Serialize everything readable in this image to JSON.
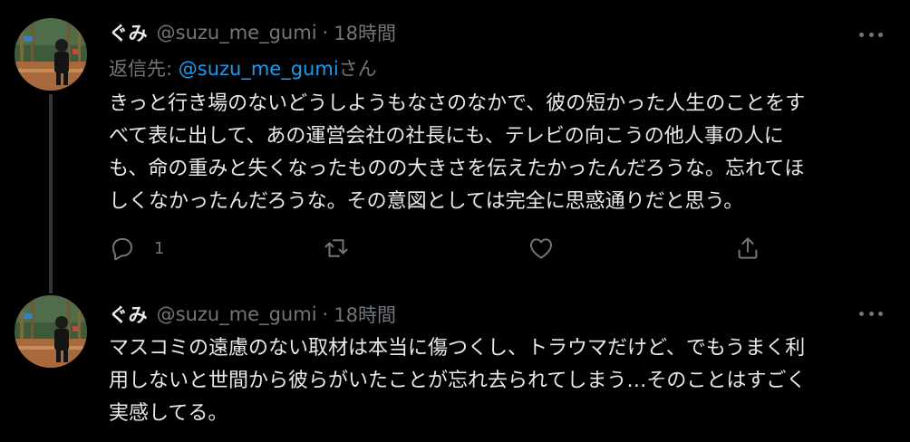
{
  "colors": {
    "background": "#000000",
    "primary_text": "#e7e9ea",
    "secondary_text": "#71767b",
    "link": "#1d9bf0",
    "thread_line": "#333639"
  },
  "tweets": [
    {
      "display_name": "ぐみ",
      "handle": "@suzu_me_gumi",
      "separator": "·",
      "time": "18時間",
      "reply_label": "返信先: ",
      "reply_mention": "@suzu_me_gumi",
      "reply_suffix": "さん",
      "lines": [
        "きっと行き場のないどうしようもなさのなかで、彼の短かった人生のことをす",
        "べて表に出して、あの運営会社の社長にも、テレビの向こうの他人事の人に",
        "も、命の重みと失くなったものの大きさを伝えたかったんだろうな。忘れてほ",
        "しくなかったんだろうな。その意図としては完全に思惑通りだと思う。"
      ],
      "reply_count": "1",
      "icons": {
        "avatar": "user-avatar",
        "more": "more-options-icon",
        "reply": "reply-icon",
        "retweet": "retweet-icon",
        "like": "heart-icon",
        "share": "share-icon"
      }
    },
    {
      "display_name": "ぐみ",
      "handle": "@suzu_me_gumi",
      "separator": "·",
      "time": "18時間",
      "lines": [
        "マスコミの遠慮のない取材は本当に傷つくし、トラウマだけど、でもうまく利",
        "用しないと世間から彼らがいたことが忘れ去られてしまう…そのことはすごく",
        "実感してる。"
      ],
      "icons": {
        "avatar": "user-avatar",
        "more": "more-options-icon"
      }
    }
  ]
}
